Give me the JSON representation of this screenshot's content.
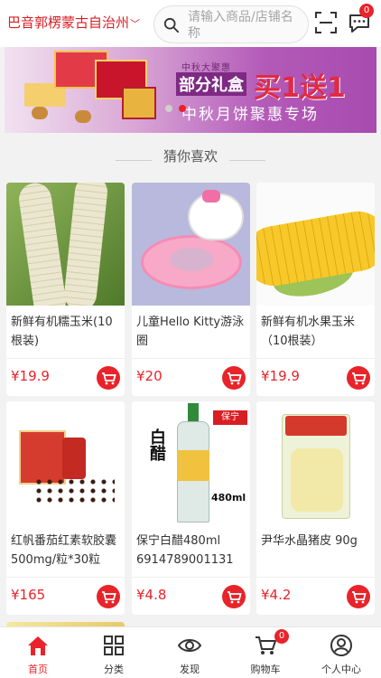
{
  "header": {
    "location": "巴音郭楞蒙古自治州",
    "search_placeholder": "请输入商品/店铺名称",
    "message_badge": "0"
  },
  "banner": {
    "small_text": "中秋大聚惠",
    "mid_text": "部分礼盒",
    "big_text": "买1送1",
    "line_text": "中秋月饼聚惠专场",
    "slide_count": 2,
    "active_slide": 2
  },
  "section_title": "猜你喜欢",
  "products": [
    {
      "name": "新鲜有机糯玉米(10根装)",
      "price": "¥19.9",
      "image": "white-corn"
    },
    {
      "name": "儿童Hello Kitty游泳圈",
      "price": "¥20",
      "image": "hello-kitty-float"
    },
    {
      "name": "新鲜有机水果玉米（10根装）",
      "price": "¥19.9",
      "image": "yellow-corn"
    },
    {
      "name": "红帆番茄红素软胶囊 500mg/粒*30粒",
      "price": "¥165",
      "image": "supplement-box"
    },
    {
      "name": "保宁白醋480ml 6914789001131",
      "price": "¥4.8",
      "image": "vinegar-bottle",
      "image_text": {
        "label": "白醋",
        "volume": "480ml",
        "brand": "保宁"
      }
    },
    {
      "name": "尹华水晶猪皮 90g",
      "price": "¥4.2",
      "image": "pork-skin-pack"
    }
  ],
  "tabbar": {
    "items": [
      {
        "label": "首页",
        "icon": "home-icon",
        "active": true
      },
      {
        "label": "分类",
        "icon": "grid-icon",
        "active": false
      },
      {
        "label": "发现",
        "icon": "eye-icon",
        "active": false
      },
      {
        "label": "购物车",
        "icon": "cart-icon",
        "active": false
      },
      {
        "label": "个人中心",
        "icon": "user-icon",
        "active": false
      }
    ],
    "cart_badge": "0"
  },
  "colors": {
    "accent": "#e8232a",
    "banner_purple": "#a84bb0",
    "background": "#f2f2f2"
  }
}
